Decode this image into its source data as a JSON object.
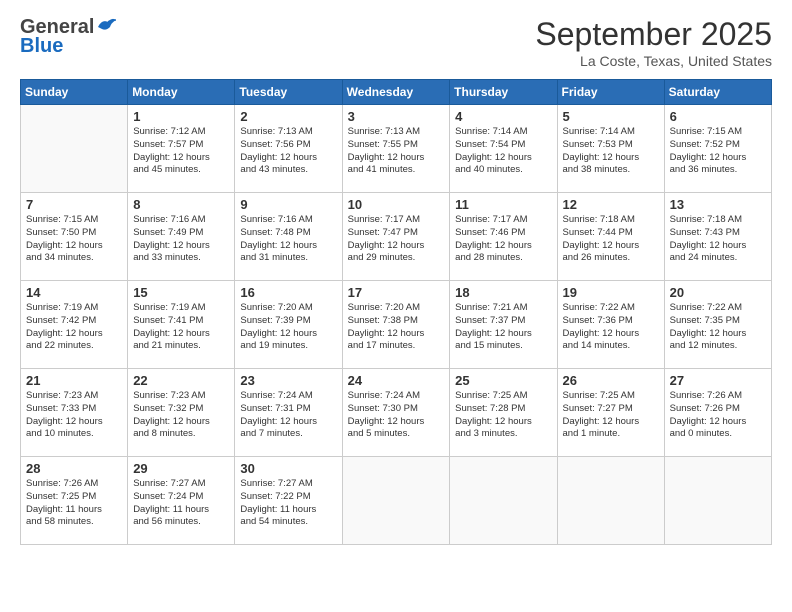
{
  "header": {
    "logo_general": "General",
    "logo_blue": "Blue",
    "month_title": "September 2025",
    "location": "La Coste, Texas, United States"
  },
  "weekdays": [
    "Sunday",
    "Monday",
    "Tuesday",
    "Wednesday",
    "Thursday",
    "Friday",
    "Saturday"
  ],
  "weeks": [
    [
      {
        "day": "",
        "info": ""
      },
      {
        "day": "1",
        "info": "Sunrise: 7:12 AM\nSunset: 7:57 PM\nDaylight: 12 hours\nand 45 minutes."
      },
      {
        "day": "2",
        "info": "Sunrise: 7:13 AM\nSunset: 7:56 PM\nDaylight: 12 hours\nand 43 minutes."
      },
      {
        "day": "3",
        "info": "Sunrise: 7:13 AM\nSunset: 7:55 PM\nDaylight: 12 hours\nand 41 minutes."
      },
      {
        "day": "4",
        "info": "Sunrise: 7:14 AM\nSunset: 7:54 PM\nDaylight: 12 hours\nand 40 minutes."
      },
      {
        "day": "5",
        "info": "Sunrise: 7:14 AM\nSunset: 7:53 PM\nDaylight: 12 hours\nand 38 minutes."
      },
      {
        "day": "6",
        "info": "Sunrise: 7:15 AM\nSunset: 7:52 PM\nDaylight: 12 hours\nand 36 minutes."
      }
    ],
    [
      {
        "day": "7",
        "info": "Sunrise: 7:15 AM\nSunset: 7:50 PM\nDaylight: 12 hours\nand 34 minutes."
      },
      {
        "day": "8",
        "info": "Sunrise: 7:16 AM\nSunset: 7:49 PM\nDaylight: 12 hours\nand 33 minutes."
      },
      {
        "day": "9",
        "info": "Sunrise: 7:16 AM\nSunset: 7:48 PM\nDaylight: 12 hours\nand 31 minutes."
      },
      {
        "day": "10",
        "info": "Sunrise: 7:17 AM\nSunset: 7:47 PM\nDaylight: 12 hours\nand 29 minutes."
      },
      {
        "day": "11",
        "info": "Sunrise: 7:17 AM\nSunset: 7:46 PM\nDaylight: 12 hours\nand 28 minutes."
      },
      {
        "day": "12",
        "info": "Sunrise: 7:18 AM\nSunset: 7:44 PM\nDaylight: 12 hours\nand 26 minutes."
      },
      {
        "day": "13",
        "info": "Sunrise: 7:18 AM\nSunset: 7:43 PM\nDaylight: 12 hours\nand 24 minutes."
      }
    ],
    [
      {
        "day": "14",
        "info": "Sunrise: 7:19 AM\nSunset: 7:42 PM\nDaylight: 12 hours\nand 22 minutes."
      },
      {
        "day": "15",
        "info": "Sunrise: 7:19 AM\nSunset: 7:41 PM\nDaylight: 12 hours\nand 21 minutes."
      },
      {
        "day": "16",
        "info": "Sunrise: 7:20 AM\nSunset: 7:39 PM\nDaylight: 12 hours\nand 19 minutes."
      },
      {
        "day": "17",
        "info": "Sunrise: 7:20 AM\nSunset: 7:38 PM\nDaylight: 12 hours\nand 17 minutes."
      },
      {
        "day": "18",
        "info": "Sunrise: 7:21 AM\nSunset: 7:37 PM\nDaylight: 12 hours\nand 15 minutes."
      },
      {
        "day": "19",
        "info": "Sunrise: 7:22 AM\nSunset: 7:36 PM\nDaylight: 12 hours\nand 14 minutes."
      },
      {
        "day": "20",
        "info": "Sunrise: 7:22 AM\nSunset: 7:35 PM\nDaylight: 12 hours\nand 12 minutes."
      }
    ],
    [
      {
        "day": "21",
        "info": "Sunrise: 7:23 AM\nSunset: 7:33 PM\nDaylight: 12 hours\nand 10 minutes."
      },
      {
        "day": "22",
        "info": "Sunrise: 7:23 AM\nSunset: 7:32 PM\nDaylight: 12 hours\nand 8 minutes."
      },
      {
        "day": "23",
        "info": "Sunrise: 7:24 AM\nSunset: 7:31 PM\nDaylight: 12 hours\nand 7 minutes."
      },
      {
        "day": "24",
        "info": "Sunrise: 7:24 AM\nSunset: 7:30 PM\nDaylight: 12 hours\nand 5 minutes."
      },
      {
        "day": "25",
        "info": "Sunrise: 7:25 AM\nSunset: 7:28 PM\nDaylight: 12 hours\nand 3 minutes."
      },
      {
        "day": "26",
        "info": "Sunrise: 7:25 AM\nSunset: 7:27 PM\nDaylight: 12 hours\nand 1 minute."
      },
      {
        "day": "27",
        "info": "Sunrise: 7:26 AM\nSunset: 7:26 PM\nDaylight: 12 hours\nand 0 minutes."
      }
    ],
    [
      {
        "day": "28",
        "info": "Sunrise: 7:26 AM\nSunset: 7:25 PM\nDaylight: 11 hours\nand 58 minutes."
      },
      {
        "day": "29",
        "info": "Sunrise: 7:27 AM\nSunset: 7:24 PM\nDaylight: 11 hours\nand 56 minutes."
      },
      {
        "day": "30",
        "info": "Sunrise: 7:27 AM\nSunset: 7:22 PM\nDaylight: 11 hours\nand 54 minutes."
      },
      {
        "day": "",
        "info": ""
      },
      {
        "day": "",
        "info": ""
      },
      {
        "day": "",
        "info": ""
      },
      {
        "day": "",
        "info": ""
      }
    ]
  ]
}
